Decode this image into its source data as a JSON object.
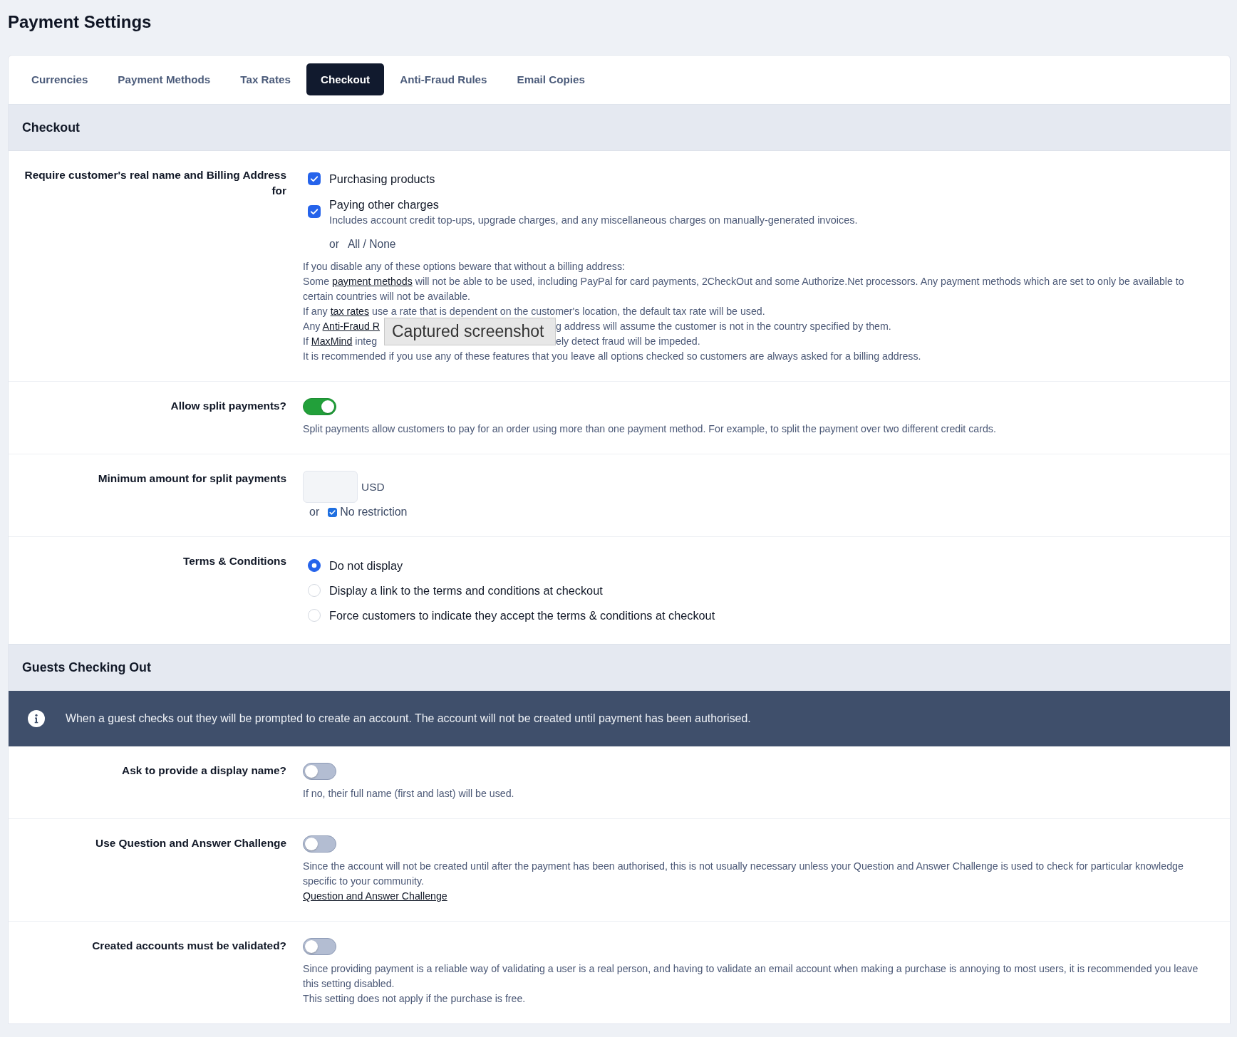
{
  "page": {
    "title": "Payment Settings"
  },
  "tabs": [
    {
      "label": "Currencies",
      "selected": false
    },
    {
      "label": "Payment Methods",
      "selected": false
    },
    {
      "label": "Tax Rates",
      "selected": false
    },
    {
      "label": "Checkout",
      "selected": true
    },
    {
      "label": "Anti-Fraud Rules",
      "selected": false
    },
    {
      "label": "Email Copies",
      "selected": false
    }
  ],
  "sections": [
    {
      "title": "Checkout",
      "rows": [
        {
          "kind": "checkboxes",
          "label": "Require customer's real name and Billing Address for",
          "options": [
            {
              "label": "Purchasing products",
              "checked": true
            },
            {
              "label": "Paying other charges",
              "checked": true,
              "description": "Includes account credit top-ups, upgrade charges, and any miscellaneous charges on manually-generated invoices."
            }
          ],
          "or_text": "or",
          "all_none": "All / None",
          "notes": [
            {
              "parts": [
                {
                  "kind": "text",
                  "text": "If you disable any of these options beware that without a billing address:"
                }
              ]
            },
            {
              "parts": [
                {
                  "kind": "text",
                  "text": "Some "
                },
                {
                  "kind": "link",
                  "text": "payment methods"
                },
                {
                  "kind": "text",
                  "text": " will not be able to be used, including PayPal for card payments, 2CheckOut and some Authorize.Net processors. Any payment methods which are set to only be available to certain countries will not be available."
                }
              ]
            },
            {
              "parts": [
                {
                  "kind": "text",
                  "text": "If any "
                },
                {
                  "kind": "link",
                  "text": "tax rates"
                },
                {
                  "kind": "text",
                  "text": " use a rate that is dependent on the customer's location, the default tax rate will be used."
                }
              ]
            },
            {
              "parts": [
                {
                  "kind": "text",
                  "text": "Any "
                },
                {
                  "kind": "link",
                  "text": "Anti-Fraud R"
                },
                {
                  "kind": "covered"
                },
                {
                  "kind": "text",
                  "text": "g address will assume the customer is not in the country specified by them."
                }
              ]
            },
            {
              "parts": [
                {
                  "kind": "text",
                  "text": "If "
                },
                {
                  "kind": "link",
                  "text": "MaxMind"
                },
                {
                  "kind": "text",
                  "text": " integ"
                },
                {
                  "kind": "covered"
                },
                {
                  "kind": "text",
                  "text": "ely detect fraud will be impeded."
                }
              ]
            },
            {
              "parts": [
                {
                  "kind": "text",
                  "text": "It is recommended if you use any of these features that you leave all options checked so customers are always asked for a billing address."
                }
              ]
            }
          ]
        },
        {
          "kind": "toggle",
          "label": "Allow split payments?",
          "on": true,
          "notes": [
            {
              "parts": [
                {
                  "kind": "text",
                  "text": "Split payments allow customers to pay for an order using more than one payment method. For example, to split the payment over two different credit cards."
                }
              ]
            }
          ]
        },
        {
          "kind": "amount",
          "label": "Minimum amount for split payments",
          "currency": "USD",
          "or_text": "or",
          "no_restriction": {
            "label": "No restriction",
            "checked": true
          }
        },
        {
          "kind": "radios",
          "label": "Terms & Conditions",
          "options": [
            {
              "label": "Do not display",
              "selected": true
            },
            {
              "label": "Display a link to the terms and conditions at checkout",
              "selected": false
            },
            {
              "label": "Force customers to indicate they accept the terms & conditions at checkout",
              "selected": false
            }
          ]
        }
      ]
    },
    {
      "title": "Guests Checking Out",
      "banner": {
        "text": "When a guest checks out they will be prompted to create an account. The account will not be created until payment has been authorised."
      },
      "rows": [
        {
          "kind": "toggle",
          "label": "Ask to provide a display name?",
          "on": false,
          "notes": [
            {
              "parts": [
                {
                  "kind": "text",
                  "text": "If no, their full name (first and last) will be used."
                }
              ]
            }
          ]
        },
        {
          "kind": "toggle",
          "label": "Use Question and Answer Challenge",
          "on": false,
          "notes": [
            {
              "parts": [
                {
                  "kind": "text",
                  "text": "Since the account will not be created until after the payment has been authorised, this is not usually necessary unless your Question and Answer Challenge is used to check for particular knowledge specific to your community."
                }
              ]
            },
            {
              "parts": [
                {
                  "kind": "link",
                  "text": "Question and Answer Challenge"
                }
              ]
            }
          ]
        },
        {
          "kind": "toggle",
          "label": "Created accounts must be validated?",
          "on": false,
          "notes": [
            {
              "parts": [
                {
                  "kind": "text",
                  "text": "Since providing payment is a reliable way of validating a user is a real person, and having to validate an email account when making a purchase is annoying to most users, it is recommended you leave this setting disabled."
                }
              ]
            },
            {
              "parts": [
                {
                  "kind": "text",
                  "text": "This setting does not apply if the purchase is free."
                }
              ]
            }
          ]
        }
      ]
    }
  ],
  "tooltip": {
    "text": "Captured screenshot"
  }
}
